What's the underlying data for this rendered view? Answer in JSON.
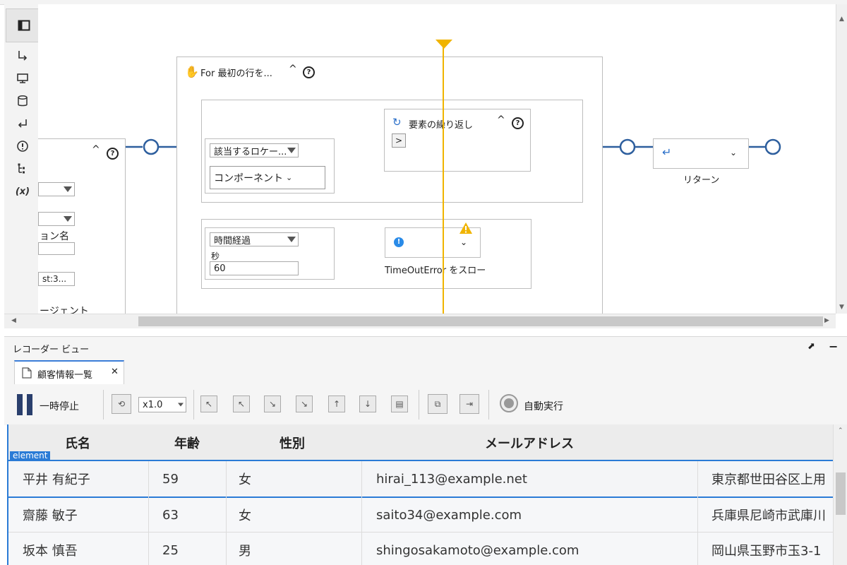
{
  "flow": {
    "for_block": {
      "title": "For 最初の行を..."
    },
    "left_partial": {
      "fragments": [
        "ョン名",
        "st:3...",
        "ージェント"
      ]
    },
    "locator": {
      "selected": "該当するロケー...",
      "component_label": "コンポーネント"
    },
    "repeat_block": {
      "title": "要素の繰り返し",
      "expand": ">"
    },
    "timeout": {
      "selected": "時間経過",
      "seconds_label": "秒",
      "seconds_value": "60"
    },
    "throw_block": {
      "caption": "TimeOutError をスロー"
    },
    "return_block": {
      "caption": "リターン"
    },
    "colors": {
      "connector": "#2e5f9e",
      "active": "#19a851",
      "marker": "#f0b400",
      "throw": "#2a8be8"
    }
  },
  "recorder": {
    "header_title": "レコーダー ビュー",
    "tab": {
      "label": "顧客情報一覧",
      "close": "✕"
    },
    "toolbar": {
      "pause_label": "一時停止",
      "speed": "x1.0",
      "auto_run_label": "自動実行"
    },
    "element_badge": "element",
    "table": {
      "columns": [
        "氏名",
        "年齢",
        "性別",
        "メールアドレス"
      ],
      "rows": [
        {
          "name": "平井 有紀子",
          "age": "59",
          "gender": "女",
          "email": "hirai_113@example.net",
          "address": "東京都世田谷区上用"
        },
        {
          "name": "齋藤 敏子",
          "age": "63",
          "gender": "女",
          "email": "saito34@example.com",
          "address": "兵庫県尼崎市武庫川"
        },
        {
          "name": "坂本 慎吾",
          "age": "25",
          "gender": "男",
          "email": "shingosakamoto@example.com",
          "address": "岡山県玉野市玉3-1"
        }
      ]
    }
  }
}
